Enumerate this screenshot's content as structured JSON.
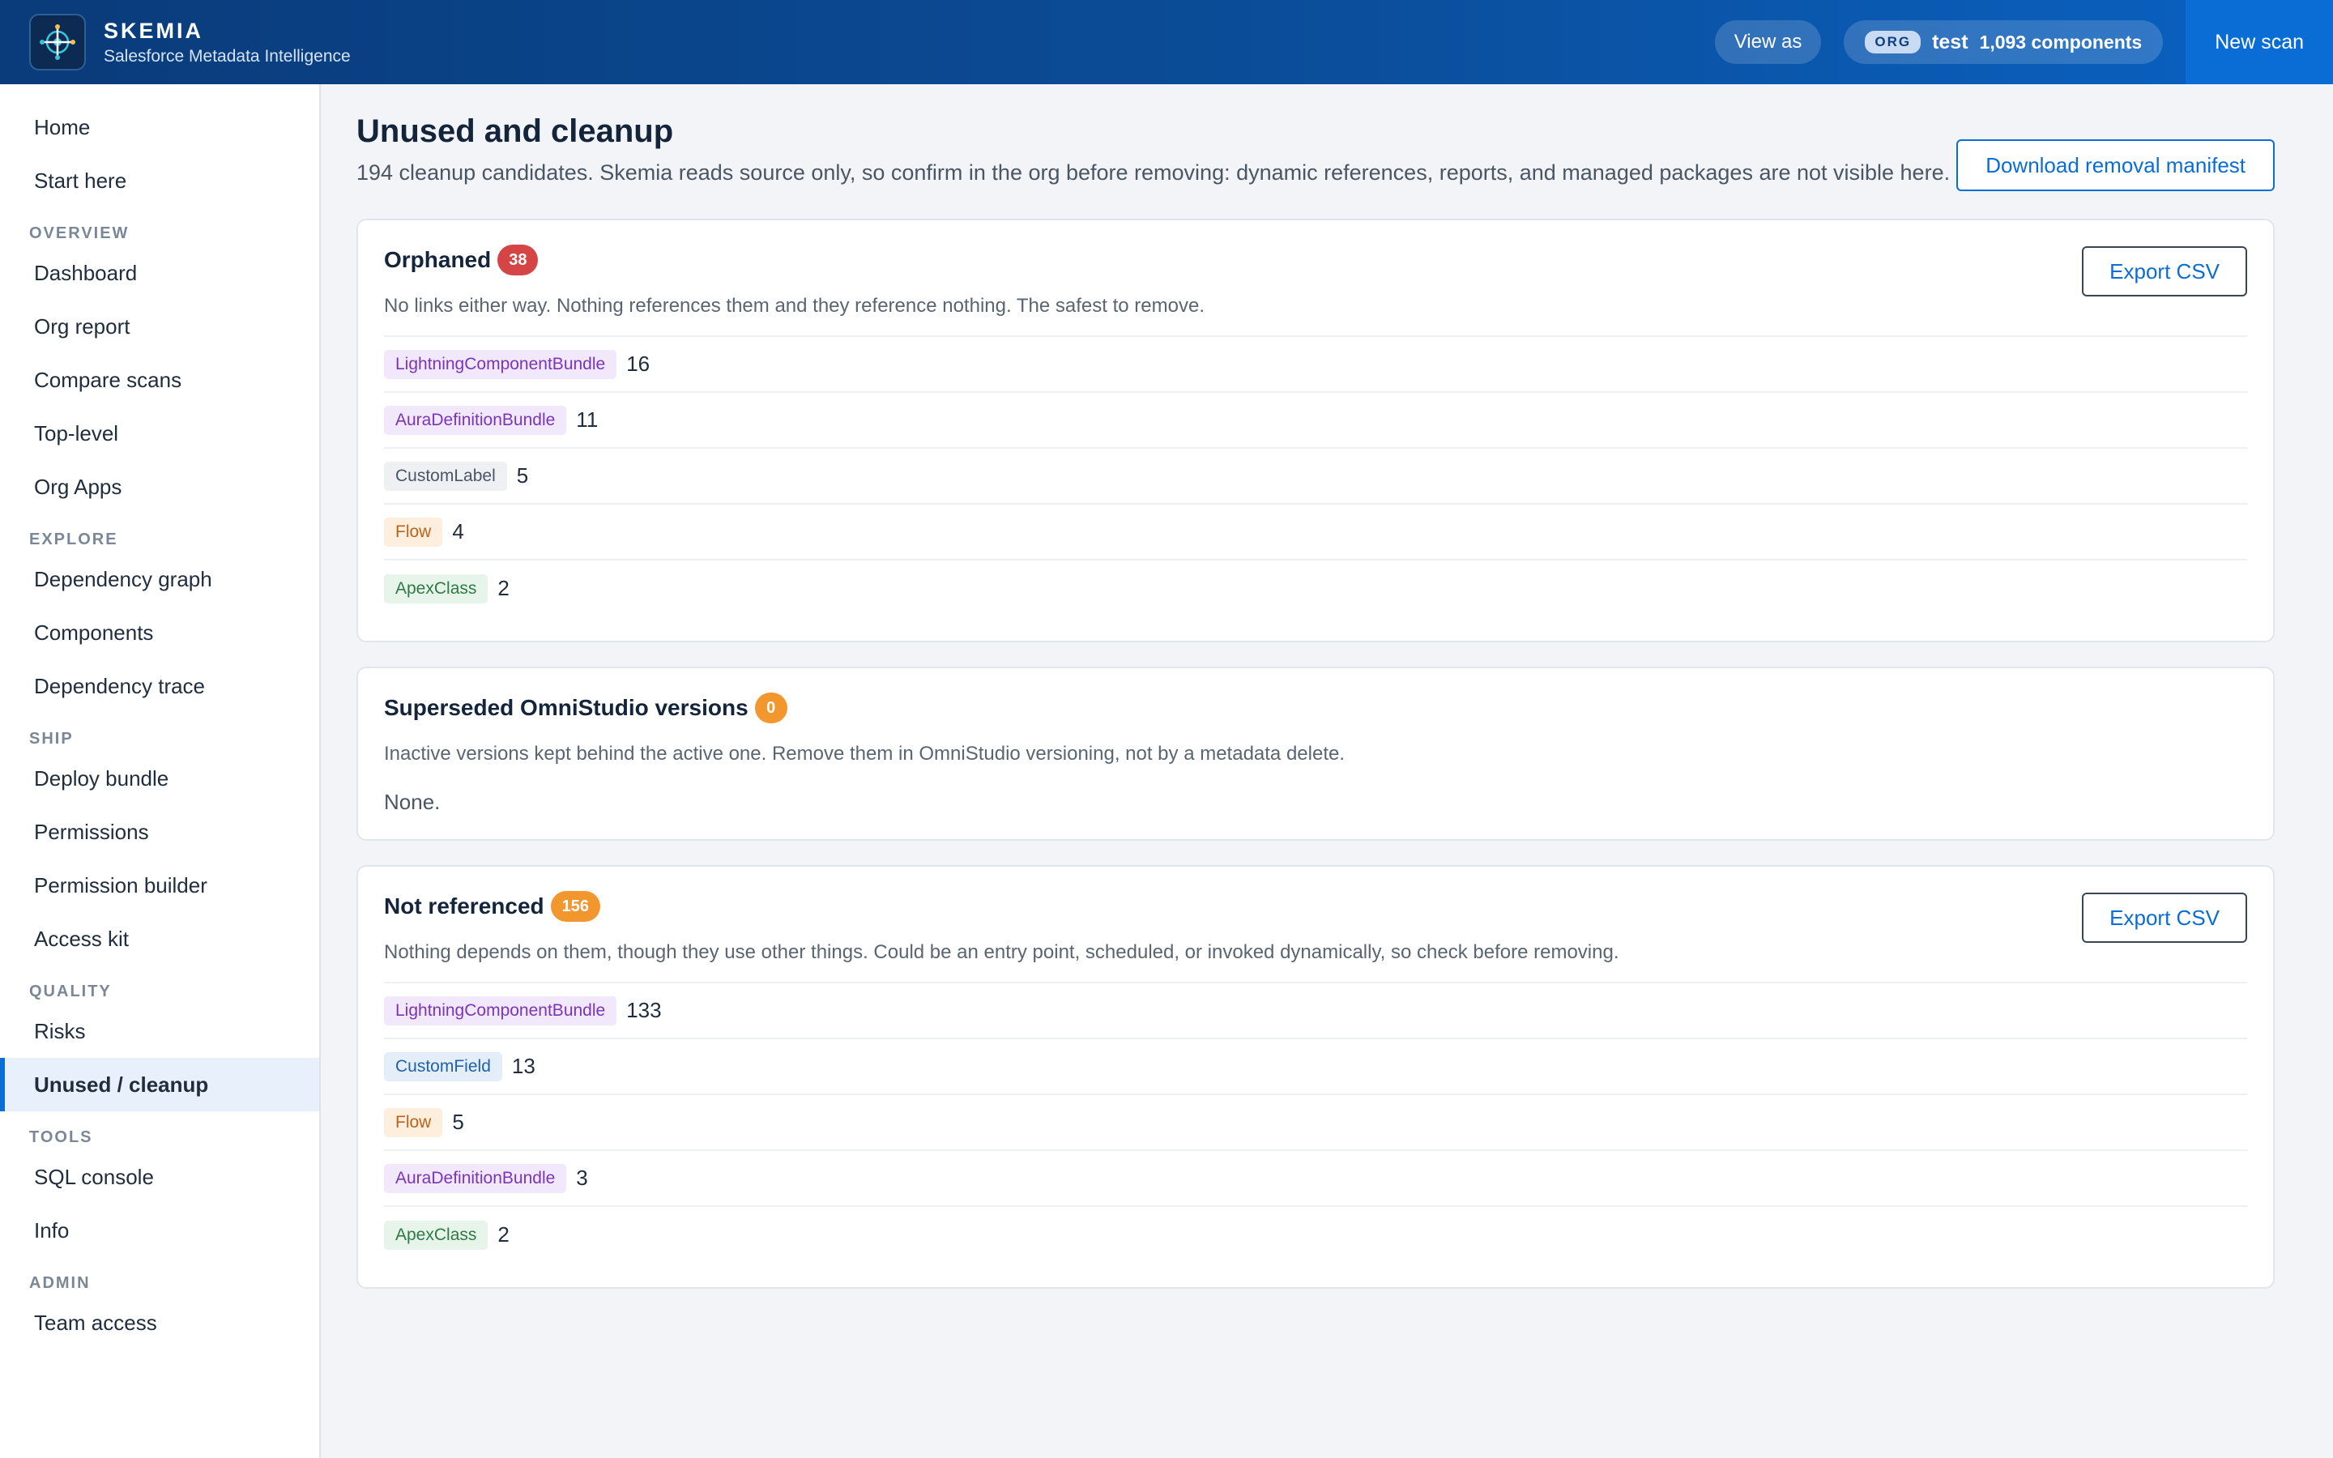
{
  "header": {
    "brand_name": "SKEMIA",
    "brand_sub": "Salesforce Metadata Intelligence",
    "view_as": "View as",
    "org_tag": "ORG",
    "org_name": "test",
    "org_count": "1,093 components",
    "new_scan": "New scan"
  },
  "sidebar": {
    "top": [
      "Home",
      "Start here"
    ],
    "sections": [
      {
        "title": "OVERVIEW",
        "items": [
          "Dashboard",
          "Org report",
          "Compare scans",
          "Top-level",
          "Org Apps"
        ]
      },
      {
        "title": "EXPLORE",
        "items": [
          "Dependency graph",
          "Components",
          "Dependency trace"
        ]
      },
      {
        "title": "SHIP",
        "items": [
          "Deploy bundle",
          "Permissions",
          "Permission builder",
          "Access kit"
        ]
      },
      {
        "title": "QUALITY",
        "items": [
          "Risks",
          "Unused / cleanup"
        ]
      },
      {
        "title": "TOOLS",
        "items": [
          "SQL console",
          "Info"
        ]
      },
      {
        "title": "ADMIN",
        "items": [
          "Team access"
        ]
      }
    ],
    "active": "Unused / cleanup"
  },
  "page": {
    "title": "Unused and cleanup",
    "subtitle": "194 cleanup candidates. Skemia reads source only, so confirm in the org before removing: dynamic references, reports, and managed packages are not visible here.",
    "download_label": "Download removal manifest"
  },
  "cards": [
    {
      "title": "Orphaned",
      "badge": "38",
      "badge_color": "red",
      "description": "No links either way. Nothing references them and they reference nothing. The safest to remove.",
      "export_label": "Export CSV",
      "rows": [
        {
          "type": "LightningComponentBundle",
          "count": "16",
          "color": "purple"
        },
        {
          "type": "AuraDefinitionBundle",
          "count": "11",
          "color": "purple"
        },
        {
          "type": "CustomLabel",
          "count": "5",
          "color": "gray"
        },
        {
          "type": "Flow",
          "count": "4",
          "color": "orange"
        },
        {
          "type": "ApexClass",
          "count": "2",
          "color": "green"
        }
      ]
    },
    {
      "title": "Superseded OmniStudio versions",
      "badge": "0",
      "badge_color": "orange",
      "description": "Inactive versions kept behind the active one. Remove them in OmniStudio versioning, not by a metadata delete.",
      "empty_text": "None.",
      "rows": []
    },
    {
      "title": "Not referenced",
      "badge": "156",
      "badge_color": "orange",
      "description": "Nothing depends on them, though they use other things. Could be an entry point, scheduled, or invoked dynamically, so check before removing.",
      "export_label": "Export CSV",
      "rows": [
        {
          "type": "LightningComponentBundle",
          "count": "133",
          "color": "purple"
        },
        {
          "type": "CustomField",
          "count": "13",
          "color": "blue"
        },
        {
          "type": "Flow",
          "count": "5",
          "color": "orange"
        },
        {
          "type": "AuraDefinitionBundle",
          "count": "3",
          "color": "purple"
        },
        {
          "type": "ApexClass",
          "count": "2",
          "color": "green"
        }
      ]
    }
  ]
}
